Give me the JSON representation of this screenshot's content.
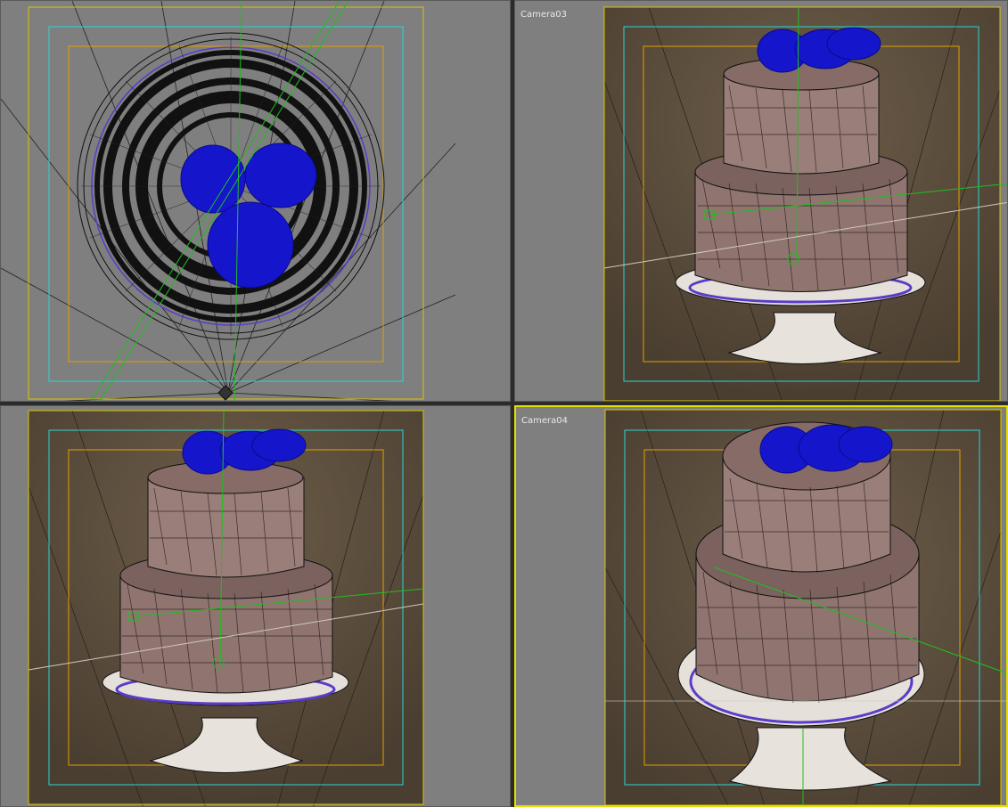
{
  "viewports": {
    "top": {
      "label": ""
    },
    "camera03": {
      "label": "Camera03"
    },
    "left": {
      "label": ""
    },
    "camera04": {
      "label": "Camera04"
    }
  },
  "colors": {
    "viewport_bg": "#7f7f7f",
    "safe_frame_outer": "#d8c400",
    "safe_frame_action": "#27d5d5",
    "safe_frame_title": "#e0a000",
    "camera_bg": "#5a4c3c",
    "cake": "#8f7470",
    "flowers": "#1515cc",
    "helper_lines": "#1fbf1f",
    "active_border": "#e5e000"
  },
  "icons": [
    "camera-target-icon",
    "light-helper-icon"
  ]
}
